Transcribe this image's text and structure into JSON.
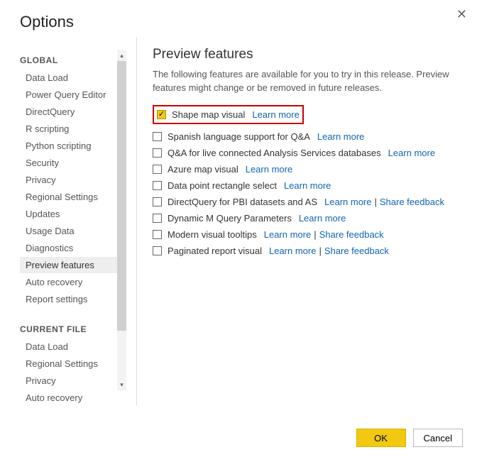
{
  "dialog": {
    "title": "Options",
    "close_glyph": "✕"
  },
  "sidebar": {
    "global_header": "GLOBAL",
    "current_file_header": "CURRENT FILE",
    "items_global": [
      "Data Load",
      "Power Query Editor",
      "DirectQuery",
      "R scripting",
      "Python scripting",
      "Security",
      "Privacy",
      "Regional Settings",
      "Updates",
      "Usage Data",
      "Diagnostics",
      "Preview features",
      "Auto recovery",
      "Report settings"
    ],
    "items_current": [
      "Data Load",
      "Regional Settings",
      "Privacy",
      "Auto recovery"
    ],
    "selected": "Preview features",
    "scroll": {
      "up": "▴",
      "down": "▾"
    }
  },
  "main": {
    "title": "Preview features",
    "description": "The following features are available for you to try in this release. Preview features might change or be removed in future releases.",
    "learn_more": "Learn more",
    "share_feedback": "Share feedback",
    "features": [
      {
        "label": "Shape map visual",
        "checked": true,
        "learn_more": true,
        "share": false,
        "highlight": true
      },
      {
        "label": "Spanish language support for Q&A",
        "checked": false,
        "learn_more": true,
        "share": false
      },
      {
        "label": "Q&A for live connected Analysis Services databases",
        "checked": false,
        "learn_more": true,
        "share": false
      },
      {
        "label": "Azure map visual",
        "checked": false,
        "learn_more": true,
        "share": false
      },
      {
        "label": "Data point rectangle select",
        "checked": false,
        "learn_more": true,
        "share": false
      },
      {
        "label": "DirectQuery for PBI datasets and AS",
        "checked": false,
        "learn_more": true,
        "share": true
      },
      {
        "label": "Dynamic M Query Parameters",
        "checked": false,
        "learn_more": true,
        "share": false
      },
      {
        "label": "Modern visual tooltips",
        "checked": false,
        "learn_more": true,
        "share": true
      },
      {
        "label": "Paginated report visual",
        "checked": false,
        "learn_more": true,
        "share": true
      }
    ]
  },
  "footer": {
    "ok": "OK",
    "cancel": "Cancel"
  }
}
